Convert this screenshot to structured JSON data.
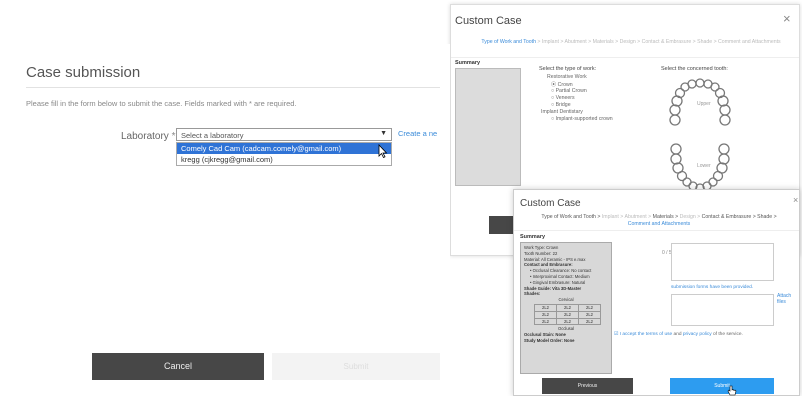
{
  "submission": {
    "title": "Case submission",
    "description": "Please fill in the form below to submit the case. Fields marked with * are required.",
    "laboratory_label": "Laboratory",
    "required_mark": "*",
    "select_placeholder": "Select a laboratory",
    "create_link": "Create a ne",
    "options": [
      "Comely Cad Cam (cadcam.comely@gmail.com)",
      "kregg (cjkregg@gmail.com)"
    ],
    "cancel_label": "Cancel",
    "submit_label": "Submit"
  },
  "custom_case_tooth": {
    "title": "Custom Case",
    "close_icon": "×",
    "steps_active": "Type of Work and Tooth",
    "steps_rest": " > Implant > Abutment > Materials > Design > Contact & Embrasure > Shade > Comment and Attachments",
    "summary_label": "Summary",
    "work_type_label": "Select the type of work:",
    "restorative_label": "Restorative Work",
    "restorative_options": [
      "Crown",
      "Partial Crown",
      "Veneers",
      "Bridge"
    ],
    "implant_label": "Implant Dentistary",
    "implant_options": [
      "Implant-supported crown"
    ],
    "tooth_label": "Select the concerned tooth:",
    "upper_label": "Upper",
    "lower_label": "Lower"
  },
  "custom_case_summary": {
    "title": "Custom Case",
    "close_icon": "×",
    "steps_a": "Type of Work and Tooth > ",
    "steps_b": "Implant > Abutment > ",
    "steps_c": "Materials > ",
    "steps_d": "Design > ",
    "steps_e": "Contact & Embrasure > Shade >",
    "steps_f": "Comment and Attachments",
    "summary_label": "Summary",
    "work_type": "Work Type: Crown",
    "tooth_number": "Tooth Number: 22",
    "material": "Material: All Ceramic - IPS e.max",
    "contact_heading": "Contact and Embrasure:",
    "contact_items": [
      "Occlusal Clearance: No contact",
      "Interproximal Contact: Medium",
      "Gingival Embrasure: Natural"
    ],
    "shade_guide": "Shade Guide: Vita 3D-Master",
    "shades_label": "Shades:",
    "cervical_label": "Cervical",
    "occlusal_label": "Occlusal",
    "shade_rows": [
      [
        "2L2",
        "2L2",
        "2L2"
      ],
      [
        "2L2",
        "2L2",
        "2L2"
      ],
      [
        "2L2",
        "2L2",
        "2L2"
      ]
    ],
    "occlusal_stain": "Occlusal Stain: None",
    "study_model": "Study Model Order: None",
    "comment_label": "Comment",
    "comment_count": "0 / 500 characters",
    "forms_link": "submission forms",
    "forms_text": " have been provided.",
    "attached_label": "Attached files",
    "attached_size": "0 / 25 Mb",
    "attach_link": "Attach files",
    "terms_a": "I accept the ",
    "terms_link1": "terms of use",
    "terms_b": " and ",
    "terms_link2": "privacy policy",
    "terms_c": " of the service.",
    "previous_label": "Previous",
    "submit_label": "Submit"
  }
}
